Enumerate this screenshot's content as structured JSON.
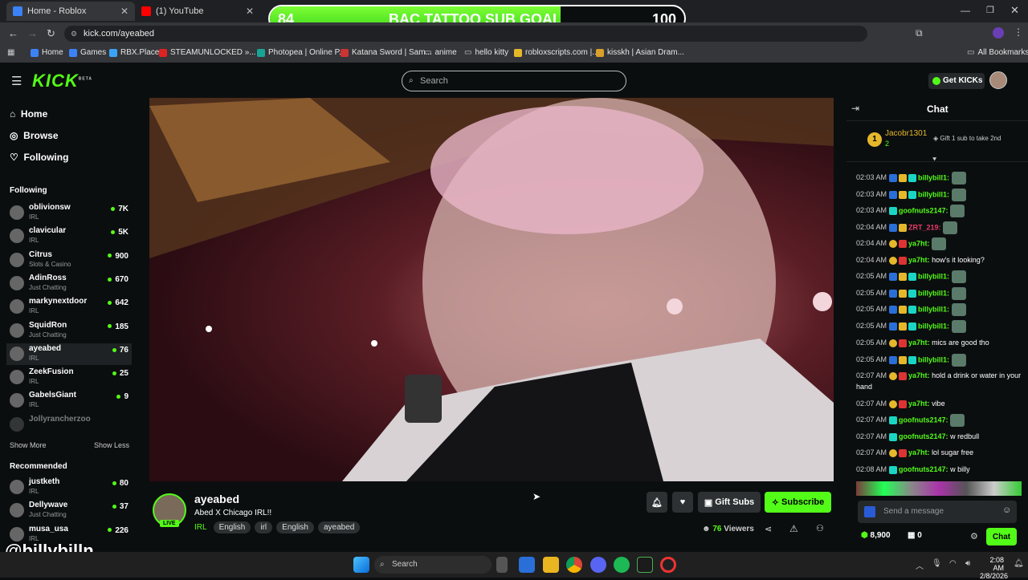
{
  "browser": {
    "tabs": [
      {
        "label": "Home - Roblox",
        "color": "#3b82f6"
      },
      {
        "label": "(1) YouTube",
        "color": "#ff0000"
      }
    ],
    "url": "kick.com/ayeabed",
    "bookmarks": [
      "Home",
      "Games",
      "RBX.Place",
      "STEAMUNLOCKED »...",
      "Photopea | Online P...",
      "Katana Sword | Sam...",
      "anime",
      "hello kitty",
      "robloxscripts.com |...",
      "kisskh | Asian Dram..."
    ],
    "all_bookmarks": "All Bookmarks"
  },
  "goal": {
    "current": "84",
    "title": "BAC TATTOO SUB GOAL",
    "target": "100",
    "progress": 0.84
  },
  "header": {
    "logo": "KICK",
    "logo_beta": "BETA",
    "search_placeholder": "Search",
    "get_kicks": "Get KICKs"
  },
  "sidebar": {
    "nav": [
      "Home",
      "Browse",
      "Following"
    ],
    "following_title": "Following",
    "following": [
      {
        "name": "oblivionsw",
        "category": "IRL",
        "viewers": "7K"
      },
      {
        "name": "clavicular",
        "category": "IRL",
        "viewers": "5K"
      },
      {
        "name": "Citrus",
        "category": "Slots & Casino",
        "viewers": "900"
      },
      {
        "name": "AdinRoss",
        "category": "Just Chatting",
        "viewers": "670"
      },
      {
        "name": "markynextdoor",
        "category": "IRL",
        "viewers": "642"
      },
      {
        "name": "SquidRon",
        "category": "Just Chatting",
        "viewers": "185"
      },
      {
        "name": "ayeabed",
        "category": "IRL",
        "viewers": "76"
      },
      {
        "name": "ZeekFusion",
        "category": "IRL",
        "viewers": "25"
      },
      {
        "name": "GabelsGiant",
        "category": "IRL",
        "viewers": "9"
      },
      {
        "name": "Jollyrancherzoo",
        "category": "",
        "viewers": ""
      }
    ],
    "show_more": "Show More",
    "show_less": "Show Less",
    "recommended_title": "Recommended",
    "recommended": [
      {
        "name": "justketh",
        "category": "IRL",
        "viewers": "80"
      },
      {
        "name": "Dellywave",
        "category": "Just Chatting",
        "viewers": "37"
      },
      {
        "name": "musa_usa",
        "category": "IRL",
        "viewers": "226"
      }
    ]
  },
  "channel": {
    "name": "ayeabed",
    "title": "Abed X Chicago IRL!!",
    "live": "LIVE",
    "category": "IRL",
    "tags": [
      "English",
      "irl",
      "English",
      "ayeabed"
    ],
    "gift_subs": "Gift Subs",
    "subscribe": "Subscribe",
    "viewers": "76",
    "viewers_label": "Viewers"
  },
  "overlay_handle": "@billybilln",
  "chat": {
    "title": "Chat",
    "pinned_user": "Jacobr1301",
    "pinned_rank": "1",
    "pinned_count": "2",
    "pinned_note": "Gift 1 sub to take 2nd",
    "messages": [
      {
        "time": "02:03 AM",
        "user": "billybill1:",
        "text": "",
        "color": "#53fc18"
      },
      {
        "time": "02:03 AM",
        "user": "billybill1:",
        "text": "",
        "color": "#53fc18"
      },
      {
        "time": "02:03 AM",
        "user": "goofnuts2147:",
        "text": "",
        "color": "#53fc18"
      },
      {
        "time": "02:04 AM",
        "user": "ZRT_219:",
        "text": "",
        "color": "#e53b6a"
      },
      {
        "time": "02:04 AM",
        "user": "ya7ht:",
        "text": "",
        "color": "#53fc18"
      },
      {
        "time": "02:04 AM",
        "user": "ya7ht:",
        "text": "how's it looking?",
        "color": "#53fc18"
      },
      {
        "time": "02:05 AM",
        "user": "billybill1:",
        "text": "",
        "color": "#53fc18"
      },
      {
        "time": "02:05 AM",
        "user": "billybill1:",
        "text": "",
        "color": "#53fc18"
      },
      {
        "time": "02:05 AM",
        "user": "billybill1:",
        "text": "",
        "color": "#53fc18"
      },
      {
        "time": "02:05 AM",
        "user": "billybill1:",
        "text": "",
        "color": "#53fc18"
      },
      {
        "time": "02:05 AM",
        "user": "ya7ht:",
        "text": "mics are good tho",
        "color": "#53fc18"
      },
      {
        "time": "02:05 AM",
        "user": "billybill1:",
        "text": "",
        "color": "#53fc18"
      },
      {
        "time": "02:07 AM",
        "user": "ya7ht:",
        "text": "hold a drink or water in your hand",
        "color": "#53fc18"
      },
      {
        "time": "02:07 AM",
        "user": "ya7ht:",
        "text": "vibe",
        "color": "#53fc18"
      },
      {
        "time": "02:07 AM",
        "user": "goofnuts2147:",
        "text": "",
        "color": "#53fc18"
      },
      {
        "time": "02:07 AM",
        "user": "goofnuts2147:",
        "text": "w redbull",
        "color": "#53fc18"
      },
      {
        "time": "02:07 AM",
        "user": "ya7ht:",
        "text": "lol sugar free",
        "color": "#53fc18"
      },
      {
        "time": "02:08 AM",
        "user": "goofnuts2147:",
        "text": "w billy",
        "color": "#53fc18"
      }
    ],
    "send_placeholder": "Send a message",
    "points": "8,900",
    "other_count": "0",
    "chat_button": "Chat"
  },
  "taskbar": {
    "search": "Search",
    "time": "2:08 AM",
    "date": "2/8/2026"
  }
}
